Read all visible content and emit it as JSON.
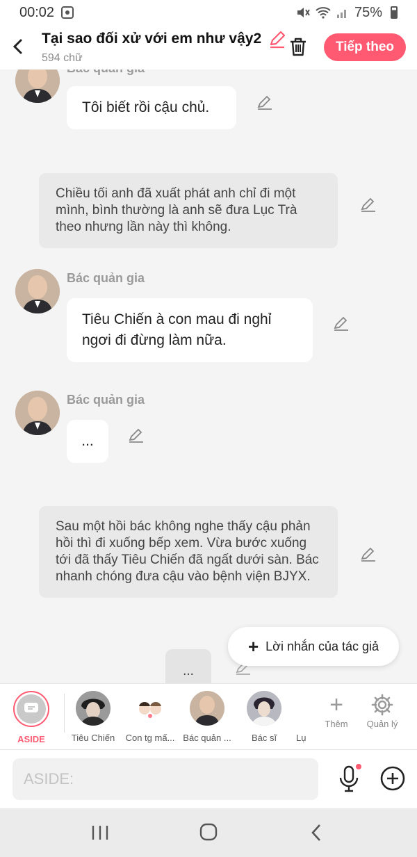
{
  "status_bar": {
    "time": "00:02",
    "battery": "75%"
  },
  "header": {
    "title": "Tại sao đối xử với em như vậy2",
    "word_count": "594 chữ",
    "next_label": "Tiếp theo"
  },
  "messages": [
    {
      "type": "character",
      "speaker": "Bác quản gia",
      "text": "Tôi biết rồi cậu chủ."
    },
    {
      "type": "narration",
      "text": "Chiều tối anh đã xuất phát anh chỉ đi một mình, bình thường là anh sẽ đưa Lục Trà theo nhưng lần này thì không."
    },
    {
      "type": "character",
      "speaker": "Bác quản gia",
      "text": "Tiêu Chiến à con mau đi nghỉ ngơi đi đừng làm nữa."
    },
    {
      "type": "character",
      "speaker": "Bác quản gia",
      "text": "..."
    },
    {
      "type": "narration",
      "text": "Sau một hồi bác không nghe thấy cậu phản hồi thì đi xuống bếp xem. Vừa bước xuống tới đã thấy Tiêu Chiến đã ngất dưới sàn. Bác nhanh chóng đưa cậu vào bệnh viện BJYX."
    },
    {
      "type": "typing",
      "text": "..."
    }
  ],
  "author_note_label": "Lời nhắn của tác giả",
  "characters": [
    {
      "name": "ASIDE"
    },
    {
      "name": "Tiêu Chiến"
    },
    {
      "name": "Con tg mấ..."
    },
    {
      "name": "Bác quản ..."
    },
    {
      "name": "Bác sĩ"
    },
    {
      "name": "Lụ"
    }
  ],
  "tools": {
    "add_label": "Thêm",
    "manage_label": "Quản lý"
  },
  "input": {
    "placeholder": "ASIDE:"
  },
  "colors": {
    "accent": "#ff5a72",
    "narration_bg": "#e9e9e9",
    "background": "#f4f4f4"
  }
}
